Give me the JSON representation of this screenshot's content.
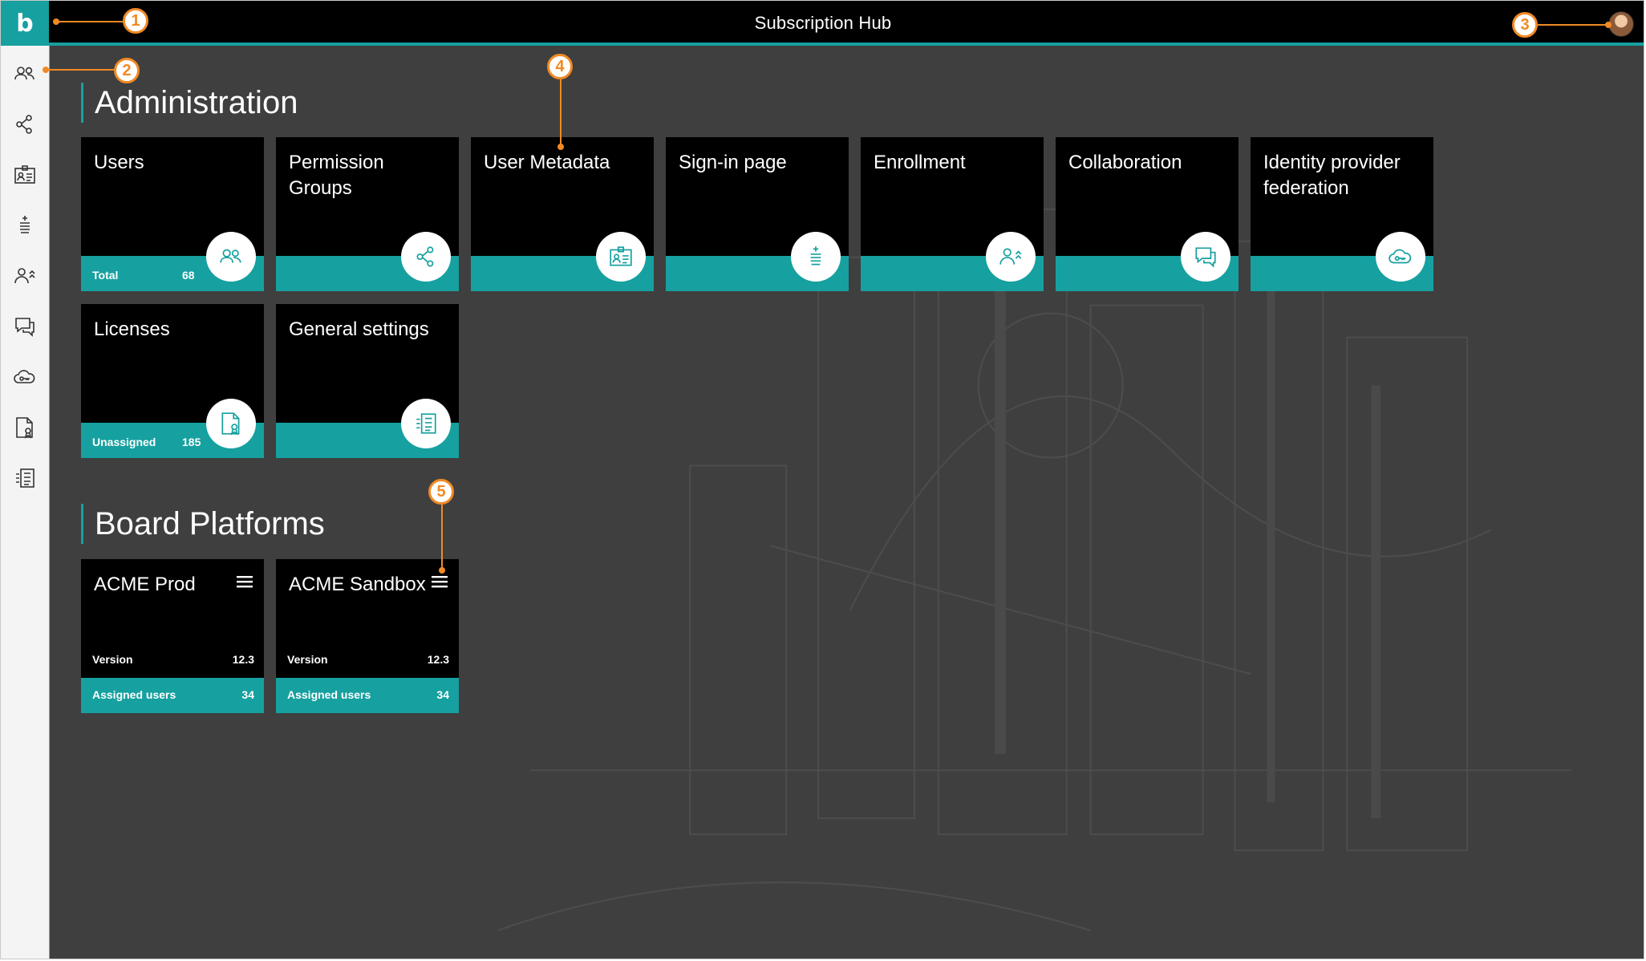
{
  "header": {
    "title": "Subscription Hub",
    "logo_letter": "b"
  },
  "sidebar": {
    "items": [
      {
        "icon": "users-icon"
      },
      {
        "icon": "permission-groups-icon"
      },
      {
        "icon": "user-metadata-icon"
      },
      {
        "icon": "sign-in-page-icon"
      },
      {
        "icon": "enrollment-icon"
      },
      {
        "icon": "collaboration-icon"
      },
      {
        "icon": "identity-federation-icon"
      },
      {
        "icon": "licenses-icon"
      },
      {
        "icon": "general-settings-icon"
      }
    ]
  },
  "administration": {
    "title": "Administration",
    "tiles": [
      {
        "title": "Users",
        "footer_label": "Total",
        "footer_value": "68",
        "icon": "users-icon"
      },
      {
        "title": "Permission Groups",
        "icon": "permission-groups-icon"
      },
      {
        "title": "User Metadata",
        "icon": "user-metadata-icon"
      },
      {
        "title": "Sign-in page",
        "icon": "sign-in-page-icon"
      },
      {
        "title": "Enrollment",
        "icon": "enrollment-icon"
      },
      {
        "title": "Collaboration",
        "icon": "collaboration-icon"
      },
      {
        "title": "Identity provider federation",
        "icon": "identity-federation-icon"
      },
      {
        "title": "Licenses",
        "footer_label": "Unassigned",
        "footer_value": "185",
        "icon": "licenses-icon"
      },
      {
        "title": "General settings",
        "icon": "general-settings-icon"
      }
    ]
  },
  "platforms": {
    "title": "Board Platforms",
    "items": [
      {
        "name": "ACME Prod",
        "version_label": "Version",
        "version": "12.3",
        "users_label": "Assigned users",
        "users": "34"
      },
      {
        "name": "ACME Sandbox",
        "version_label": "Version",
        "version": "12.3",
        "users_label": "Assigned users",
        "users": "34"
      }
    ]
  },
  "callouts": [
    "1",
    "2",
    "3",
    "4",
    "5"
  ],
  "colors": {
    "accent": "#17a0a0",
    "callout": "#f08a24",
    "header": "#000000",
    "background": "#3f3f3f"
  }
}
